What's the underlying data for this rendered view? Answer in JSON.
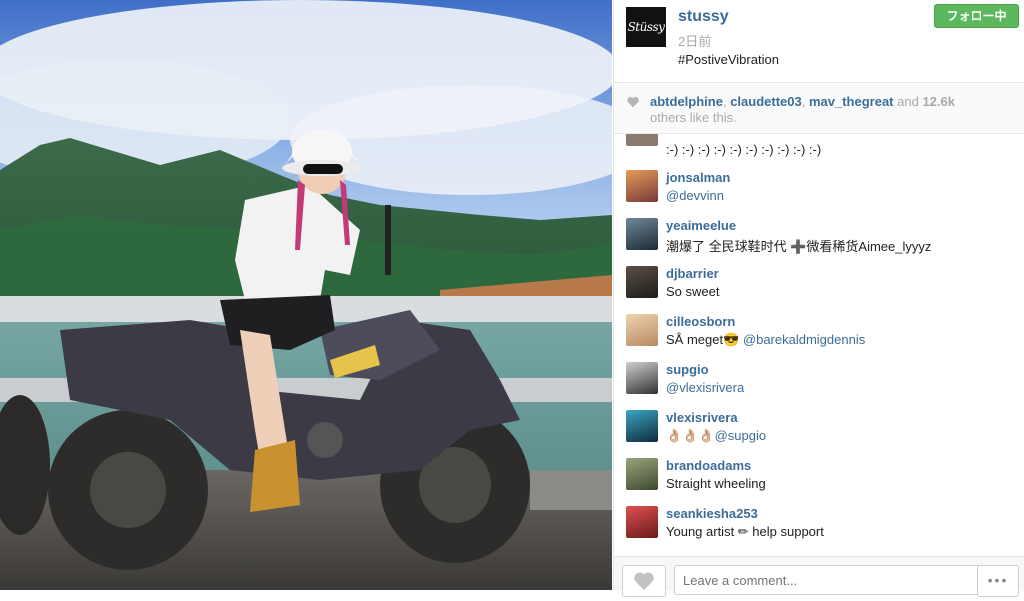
{
  "post": {
    "username": "stussy",
    "logo_text": "Stüssy",
    "time_ago": "2日前",
    "caption": "#PostiveVibration",
    "follow_label": "フォロー中"
  },
  "likes": {
    "user1": "abtdelphine",
    "sep1": ", ",
    "user2": "claudette03",
    "sep2": ", ",
    "user3": "mav_thegreat",
    "and": " and ",
    "count": "12.6k",
    "suffix": "others like this."
  },
  "comments": [
    {
      "user": "",
      "text": ":-) :-) :-) :-) :-) :-) :-) :-) :-) :-)",
      "mention": "",
      "avatar_color": "#8a7a70"
    },
    {
      "user": "jonsalman",
      "text": "",
      "mention": "@devvinn",
      "avatar_color": "#b86a3a"
    },
    {
      "user": "yeaimeelue",
      "text": "潮爆了 全民球鞋时代 ➕微看稀货Aimee_lyyyz",
      "mention": "",
      "avatar_color": "#2f4a5a"
    },
    {
      "user": "djbarrier",
      "text": "So sweet",
      "mention": "",
      "avatar_color": "#3a3530"
    },
    {
      "user": "cilleosborn",
      "text": "SÅ meget😎 ",
      "mention": "@barekaldmigdennis",
      "avatar_color": "#d6b28a"
    },
    {
      "user": "supgio",
      "text": "",
      "mention": "@vlexisrivera",
      "avatar_color": "#555555"
    },
    {
      "user": "vlexisrivera",
      "text": "👌🏼👌🏼👌🏼",
      "mention": "@supgio",
      "avatar_color": "#1f6f8a"
    },
    {
      "user": "brandoadams",
      "text": "Straight wheeling",
      "mention": "",
      "avatar_color": "#6a7a50"
    },
    {
      "user": "seankiesha253",
      "text": "Young artist ✏ help support",
      "mention": "",
      "avatar_color": "#b03030"
    }
  ],
  "footer": {
    "comment_placeholder": "Leave a comment...",
    "more_label": "•••"
  },
  "colors": {
    "link": "#3b6d99",
    "follow_bg": "#5cb85c"
  }
}
